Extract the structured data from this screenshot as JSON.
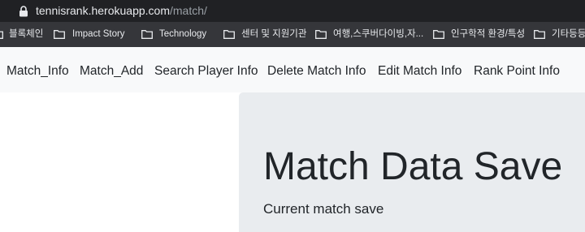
{
  "browser": {
    "url_host": "tennisrank.herokuapp.com",
    "url_path": "/match/"
  },
  "bookmarks": [
    {
      "label": "블록체인",
      "icon": "folder-icon"
    },
    {
      "label": "Impact Story",
      "icon": "folder-icon"
    },
    {
      "label": "Technology",
      "icon": "folder-icon"
    },
    {
      "label": "센터 및 지원기관",
      "icon": "folder-icon"
    },
    {
      "label": "여행,스쿠버다이빙,자...",
      "icon": "folder-icon"
    },
    {
      "label": "인구학적 환경/특성",
      "icon": "folder-icon"
    },
    {
      "label": "기타등등",
      "icon": "folder-icon"
    }
  ],
  "nav": {
    "items": [
      {
        "label": "Match_Info"
      },
      {
        "label": "Match_Add"
      },
      {
        "label": "Search Player Info"
      },
      {
        "label": "Delete Match Info"
      },
      {
        "label": "Edit Match Info"
      },
      {
        "label": "Rank Point Info"
      }
    ]
  },
  "jumbotron": {
    "title": "Match Data Save",
    "lead": "Current match save"
  },
  "colors": {
    "url_bar_bg": "#202124",
    "bookmarks_bg": "#35363a",
    "navbar_bg": "#f8f9fa",
    "jumbotron_bg": "#e9ecef",
    "text": "#212529"
  }
}
